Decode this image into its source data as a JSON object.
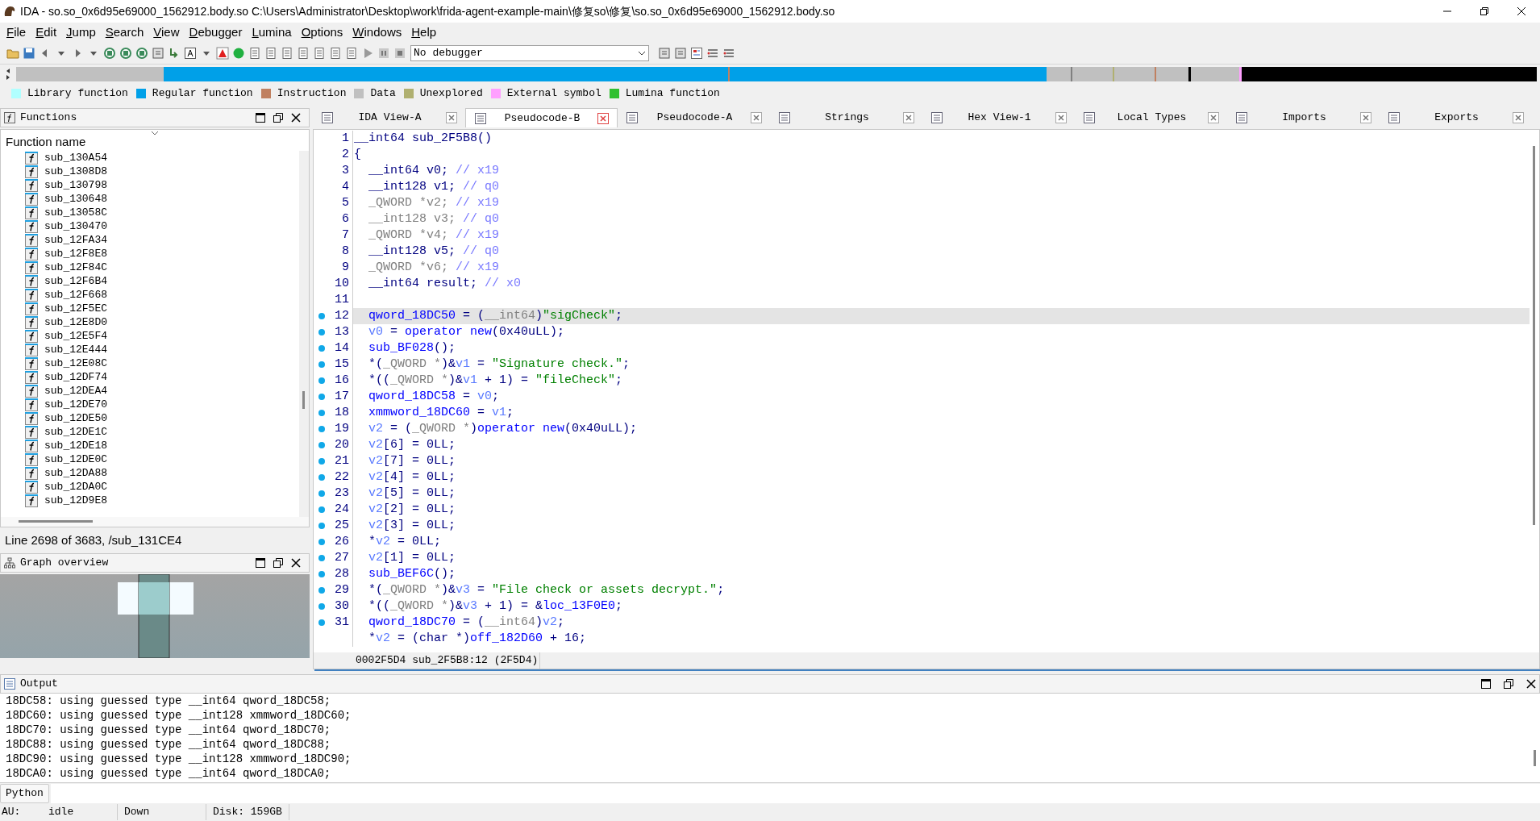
{
  "window": {
    "title": "IDA - so.so_0x6d95e69000_1562912.body.so C:\\Users\\Administrator\\Desktop\\work\\frida-agent-example-main\\修复so\\修复\\so.so_0x6d95e69000_1562912.body.so"
  },
  "menu": [
    "File",
    "Edit",
    "Jump",
    "Search",
    "View",
    "Debugger",
    "Lumina",
    "Options",
    "Windows",
    "Help"
  ],
  "debugger_select": {
    "value": "No debugger"
  },
  "legend": [
    {
      "label": "Library function",
      "color": "#b0ffff"
    },
    {
      "label": "Regular function",
      "color": "#00a0e8"
    },
    {
      "label": "Instruction",
      "color": "#c08060"
    },
    {
      "label": "Data",
      "color": "#c0c0c0"
    },
    {
      "label": "Unexplored",
      "color": "#b0b070"
    },
    {
      "label": "External symbol",
      "color": "#ffa0ff"
    },
    {
      "label": "Lumina function",
      "color": "#30c030"
    }
  ],
  "functions_panel": {
    "title": "Functions",
    "column": "Function name",
    "items": [
      "sub_130A54",
      "sub_1308D8",
      "sub_130798",
      "sub_130648",
      "sub_13058C",
      "sub_130470",
      "sub_12FA34",
      "sub_12F8E8",
      "sub_12F84C",
      "sub_12F6B4",
      "sub_12F668",
      "sub_12F5EC",
      "sub_12E8D0",
      "sub_12E5F4",
      "sub_12E444",
      "sub_12E08C",
      "sub_12DF74",
      "sub_12DEA4",
      "sub_12DE70",
      "sub_12DE50",
      "sub_12DE1C",
      "sub_12DE18",
      "sub_12DE0C",
      "sub_12DA88",
      "sub_12DA0C",
      "sub_12D9E8"
    ],
    "status": "Line 2698 of 3683, /sub_131CE4"
  },
  "graph_overview": {
    "title": "Graph overview"
  },
  "tabs": [
    {
      "label": "IDA View-A",
      "selected": false
    },
    {
      "label": "Pseudocode-B",
      "selected": true
    },
    {
      "label": "Pseudocode-A",
      "selected": false
    },
    {
      "label": "Strings",
      "selected": false
    },
    {
      "label": "Hex View-1",
      "selected": false
    },
    {
      "label": "Local Types",
      "selected": false
    },
    {
      "label": "Imports",
      "selected": false
    },
    {
      "label": "Exports",
      "selected": false
    }
  ],
  "code": {
    "lines": [
      {
        "number": "1",
        "indented": false,
        "mapped": false,
        "current": false,
        "tokens": [
          {
            "kind": "plain",
            "text": "__int64 sub_2F5B8()"
          }
        ]
      },
      {
        "number": "2",
        "indented": false,
        "mapped": false,
        "current": false,
        "tokens": [
          {
            "kind": "plain",
            "text": "{"
          }
        ]
      },
      {
        "number": "3",
        "indented": true,
        "mapped": false,
        "current": false,
        "tokens": [
          {
            "kind": "plain",
            "text": "__int64 v0; "
          },
          {
            "kind": "comment",
            "text": "// x19"
          }
        ]
      },
      {
        "number": "4",
        "indented": true,
        "mapped": false,
        "current": false,
        "tokens": [
          {
            "kind": "plain",
            "text": "__int128 v1; "
          },
          {
            "kind": "comment",
            "text": "// q0"
          }
        ]
      },
      {
        "number": "5",
        "indented": true,
        "mapped": false,
        "current": false,
        "tokens": [
          {
            "kind": "gray",
            "text": "_QWORD *v2; "
          },
          {
            "kind": "comment",
            "text": "// x19"
          }
        ]
      },
      {
        "number": "6",
        "indented": true,
        "mapped": false,
        "current": false,
        "tokens": [
          {
            "kind": "gray",
            "text": "__int128 v3; "
          },
          {
            "kind": "comment",
            "text": "// q0"
          }
        ]
      },
      {
        "number": "7",
        "indented": true,
        "mapped": false,
        "current": false,
        "tokens": [
          {
            "kind": "gray",
            "text": "_QWORD *v4; "
          },
          {
            "kind": "comment",
            "text": "// x19"
          }
        ]
      },
      {
        "number": "8",
        "indented": true,
        "mapped": false,
        "current": false,
        "tokens": [
          {
            "kind": "plain",
            "text": "__int128 v5; "
          },
          {
            "kind": "comment",
            "text": "// q0"
          }
        ]
      },
      {
        "number": "9",
        "indented": true,
        "mapped": false,
        "current": false,
        "tokens": [
          {
            "kind": "gray",
            "text": "_QWORD *v6; "
          },
          {
            "kind": "comment",
            "text": "// x19"
          }
        ]
      },
      {
        "number": "10",
        "indented": true,
        "mapped": false,
        "current": false,
        "tokens": [
          {
            "kind": "plain",
            "text": "__int64 result; "
          },
          {
            "kind": "comment",
            "text": "// x0"
          }
        ]
      },
      {
        "number": "11",
        "indented": false,
        "mapped": false,
        "current": false
      },
      {
        "number": "12",
        "indented": true,
        "mapped": true,
        "current": true,
        "tokens": [
          {
            "kind": "global",
            "text": "qword_18DC50"
          },
          {
            "kind": "plain",
            "text": " = ("
          },
          {
            "kind": "gray",
            "text": "__int64"
          },
          {
            "kind": "plain",
            "text": ")"
          },
          {
            "kind": "string",
            "text": "\"sigCheck\""
          },
          {
            "kind": "plain",
            "text": ";"
          }
        ]
      },
      {
        "number": "13",
        "indented": true,
        "mapped": true,
        "current": false,
        "tokens": [
          {
            "kind": "local",
            "text": "v0"
          },
          {
            "kind": "plain",
            "text": " = "
          },
          {
            "kind": "global",
            "text": "operator new"
          },
          {
            "kind": "plain",
            "text": "(0x40uLL);"
          }
        ]
      },
      {
        "number": "14",
        "indented": true,
        "mapped": true,
        "current": false,
        "tokens": [
          {
            "kind": "global",
            "text": "sub_BF028"
          },
          {
            "kind": "plain",
            "text": "();"
          }
        ]
      },
      {
        "number": "15",
        "indented": true,
        "mapped": true,
        "current": false,
        "tokens": [
          {
            "kind": "plain",
            "text": "*("
          },
          {
            "kind": "gray",
            "text": "_QWORD *"
          },
          {
            "kind": "plain",
            "text": ")&"
          },
          {
            "kind": "local",
            "text": "v1"
          },
          {
            "kind": "plain",
            "text": " = "
          },
          {
            "kind": "string",
            "text": "\"Signature check.\""
          },
          {
            "kind": "plain",
            "text": ";"
          }
        ]
      },
      {
        "number": "16",
        "indented": true,
        "mapped": true,
        "current": false,
        "tokens": [
          {
            "kind": "plain",
            "text": "*(("
          },
          {
            "kind": "gray",
            "text": "_QWORD *"
          },
          {
            "kind": "plain",
            "text": ")&"
          },
          {
            "kind": "local",
            "text": "v1"
          },
          {
            "kind": "plain",
            "text": " + 1) = "
          },
          {
            "kind": "string",
            "text": "\"fileCheck\""
          },
          {
            "kind": "plain",
            "text": ";"
          }
        ]
      },
      {
        "number": "17",
        "indented": true,
        "mapped": true,
        "current": false,
        "tokens": [
          {
            "kind": "global",
            "text": "qword_18DC58"
          },
          {
            "kind": "plain",
            "text": " = "
          },
          {
            "kind": "local",
            "text": "v0"
          },
          {
            "kind": "plain",
            "text": ";"
          }
        ]
      },
      {
        "number": "18",
        "indented": true,
        "mapped": true,
        "current": false,
        "tokens": [
          {
            "kind": "global",
            "text": "xmmword_18DC60"
          },
          {
            "kind": "plain",
            "text": " = "
          },
          {
            "kind": "local",
            "text": "v1"
          },
          {
            "kind": "plain",
            "text": ";"
          }
        ]
      },
      {
        "number": "19",
        "indented": true,
        "mapped": true,
        "current": false,
        "tokens": [
          {
            "kind": "local",
            "text": "v2"
          },
          {
            "kind": "plain",
            "text": " = ("
          },
          {
            "kind": "gray",
            "text": "_QWORD *"
          },
          {
            "kind": "plain",
            "text": ")"
          },
          {
            "kind": "global",
            "text": "operator new"
          },
          {
            "kind": "plain",
            "text": "(0x40uLL);"
          }
        ]
      },
      {
        "number": "20",
        "indented": true,
        "mapped": true,
        "current": false,
        "tokens": [
          {
            "kind": "local",
            "text": "v2"
          },
          {
            "kind": "plain",
            "text": "[6] = 0LL;"
          }
        ]
      },
      {
        "number": "21",
        "indented": true,
        "mapped": true,
        "current": false,
        "tokens": [
          {
            "kind": "local",
            "text": "v2"
          },
          {
            "kind": "plain",
            "text": "[7] = 0LL;"
          }
        ]
      },
      {
        "number": "22",
        "indented": true,
        "mapped": true,
        "current": false,
        "tokens": [
          {
            "kind": "local",
            "text": "v2"
          },
          {
            "kind": "plain",
            "text": "[4] = 0LL;"
          }
        ]
      },
      {
        "number": "23",
        "indented": true,
        "mapped": true,
        "current": false,
        "tokens": [
          {
            "kind": "local",
            "text": "v2"
          },
          {
            "kind": "plain",
            "text": "[5] = 0LL;"
          }
        ]
      },
      {
        "number": "24",
        "indented": true,
        "mapped": true,
        "current": false,
        "tokens": [
          {
            "kind": "local",
            "text": "v2"
          },
          {
            "kind": "plain",
            "text": "[2] = 0LL;"
          }
        ]
      },
      {
        "number": "25",
        "indented": true,
        "mapped": true,
        "current": false,
        "tokens": [
          {
            "kind": "local",
            "text": "v2"
          },
          {
            "kind": "plain",
            "text": "[3] = 0LL;"
          }
        ]
      },
      {
        "number": "26",
        "indented": true,
        "mapped": true,
        "current": false,
        "tokens": [
          {
            "kind": "plain",
            "text": "*"
          },
          {
            "kind": "local",
            "text": "v2"
          },
          {
            "kind": "plain",
            "text": " = 0LL;"
          }
        ]
      },
      {
        "number": "27",
        "indented": true,
        "mapped": true,
        "current": false,
        "tokens": [
          {
            "kind": "local",
            "text": "v2"
          },
          {
            "kind": "plain",
            "text": "[1] = 0LL;"
          }
        ]
      },
      {
        "number": "28",
        "indented": true,
        "mapped": true,
        "current": false,
        "tokens": [
          {
            "kind": "global",
            "text": "sub_BEF6C"
          },
          {
            "kind": "plain",
            "text": "();"
          }
        ]
      },
      {
        "number": "29",
        "indented": true,
        "mapped": true,
        "current": false,
        "tokens": [
          {
            "kind": "plain",
            "text": "*("
          },
          {
            "kind": "gray",
            "text": "_QWORD *"
          },
          {
            "kind": "plain",
            "text": ")&"
          },
          {
            "kind": "local",
            "text": "v3"
          },
          {
            "kind": "plain",
            "text": " = "
          },
          {
            "kind": "string",
            "text": "\"File check or assets decrypt.\""
          },
          {
            "kind": "plain",
            "text": ";"
          }
        ]
      },
      {
        "number": "30",
        "indented": true,
        "mapped": true,
        "current": false,
        "tokens": [
          {
            "kind": "plain",
            "text": "*(("
          },
          {
            "kind": "gray",
            "text": "_QWORD *"
          },
          {
            "kind": "plain",
            "text": ")&"
          },
          {
            "kind": "local",
            "text": "v3"
          },
          {
            "kind": "plain",
            "text": " + 1) = &"
          },
          {
            "kind": "global",
            "text": "loc_13F0E0"
          },
          {
            "kind": "plain",
            "text": ";"
          }
        ]
      },
      {
        "number": "31",
        "indented": true,
        "mapped": true,
        "current": false,
        "tokens": [
          {
            "kind": "global",
            "text": "qword_18DC70"
          },
          {
            "kind": "plain",
            "text": " = ("
          },
          {
            "kind": "gray",
            "text": "__int64"
          },
          {
            "kind": "plain",
            "text": ")"
          },
          {
            "kind": "local",
            "text": "v2"
          },
          {
            "kind": "plain",
            "text": ";"
          }
        ]
      },
      {
        "indented": true,
        "mapped": false,
        "current": false,
        "tokens": [
          {
            "kind": "plain",
            "text": "*"
          },
          {
            "kind": "local",
            "text": "v2"
          },
          {
            "kind": "plain",
            "text": " = (char *)"
          },
          {
            "kind": "global",
            "text": "off_182D60"
          },
          {
            "kind": "plain",
            "text": " + 16;"
          }
        ]
      }
    ],
    "status": "0002F5D4 sub_2F5B8:12 (2F5D4)"
  },
  "output": {
    "title": "Output",
    "lines": [
      "18DC58: using guessed type __int64 qword_18DC58;",
      "18DC60: using guessed type __int128 xmmword_18DC60;",
      "18DC70: using guessed type __int64 qword_18DC70;",
      "18DC88: using guessed type __int64 qword_18DC88;",
      "18DC90: using guessed type __int128 xmmword_18DC90;",
      "18DCA0: using guessed type __int64 qword_18DCA0;"
    ],
    "language": "Python"
  },
  "status_bar": [
    "AU:",
    "idle",
    "Down",
    "Disk: 159GB"
  ]
}
